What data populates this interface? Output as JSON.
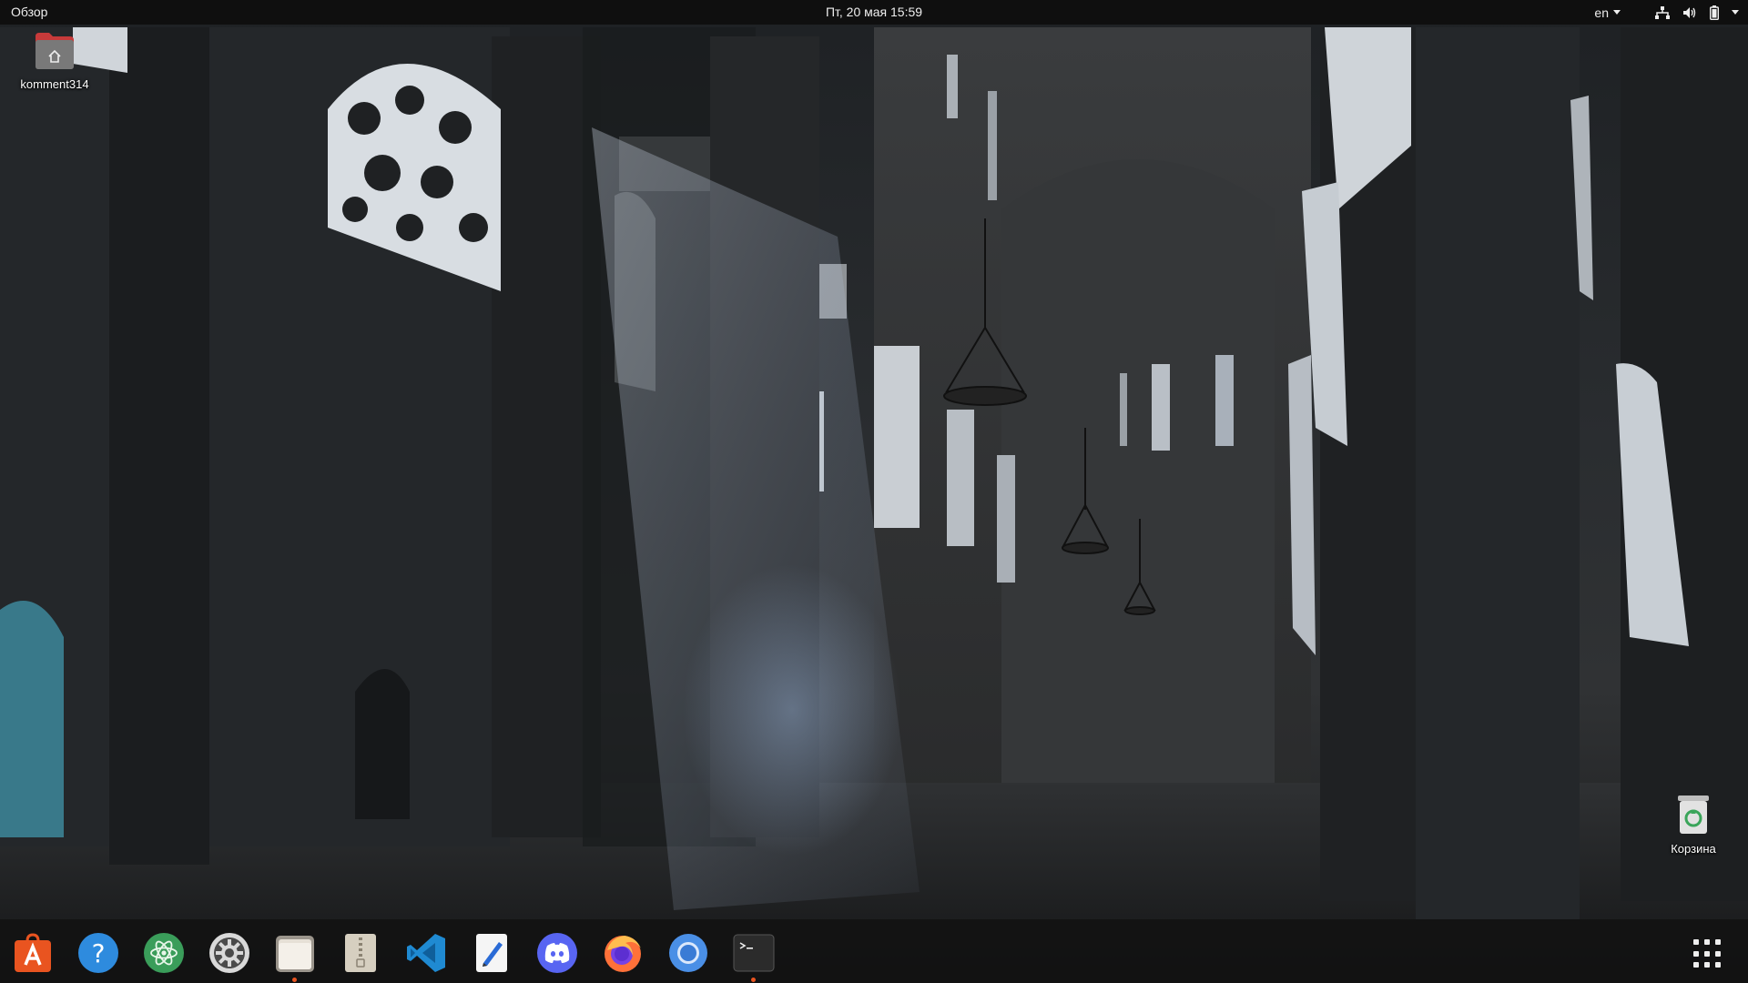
{
  "topbar": {
    "activities_label": "Обзор",
    "clock": "Пт, 20 мая  15:59",
    "language": "en",
    "icons": [
      "network-icon",
      "volume-icon",
      "battery-icon",
      "system-menu-caret-icon"
    ]
  },
  "desktop": {
    "home_folder_label": "komment314",
    "trash_label": "Корзина"
  },
  "dock": {
    "apps": [
      {
        "name": "ubuntu-software",
        "icon": "shopping-bag-icon",
        "running": false,
        "color": "#e95420"
      },
      {
        "name": "help",
        "icon": "question-mark-icon",
        "running": false,
        "color": "#2e8bde"
      },
      {
        "name": "atom-editor",
        "icon": "atom-icon",
        "running": false,
        "color": "#3a9d5a"
      },
      {
        "name": "settings",
        "icon": "gear-icon",
        "running": false,
        "color": "#c9c9c9"
      },
      {
        "name": "files",
        "icon": "folder-icon",
        "running": true,
        "color": "#d6cfc5"
      },
      {
        "name": "archive-manager",
        "icon": "zip-archive-icon",
        "running": false,
        "color": "#cfc7b8"
      },
      {
        "name": "visual-studio-code",
        "icon": "vscode-icon",
        "running": false,
        "color": "#1f8ad2"
      },
      {
        "name": "text-editor",
        "icon": "pencil-note-icon",
        "running": false,
        "color": "#f2f2f2"
      },
      {
        "name": "discord",
        "icon": "discord-icon",
        "running": false,
        "color": "#5865f2"
      },
      {
        "name": "firefox",
        "icon": "firefox-icon",
        "running": false,
        "color": "#ff7139"
      },
      {
        "name": "chromium",
        "icon": "chromium-icon",
        "running": false,
        "color": "#4a8fe6"
      },
      {
        "name": "terminal",
        "icon": "terminal-icon",
        "running": true,
        "color": "#2b2b2b"
      }
    ],
    "show_apps_icon": "app-grid-icon"
  },
  "colors": {
    "topbar_bg": "#0f0f0f",
    "dock_bg": "#121212",
    "accent": "#e95420"
  }
}
